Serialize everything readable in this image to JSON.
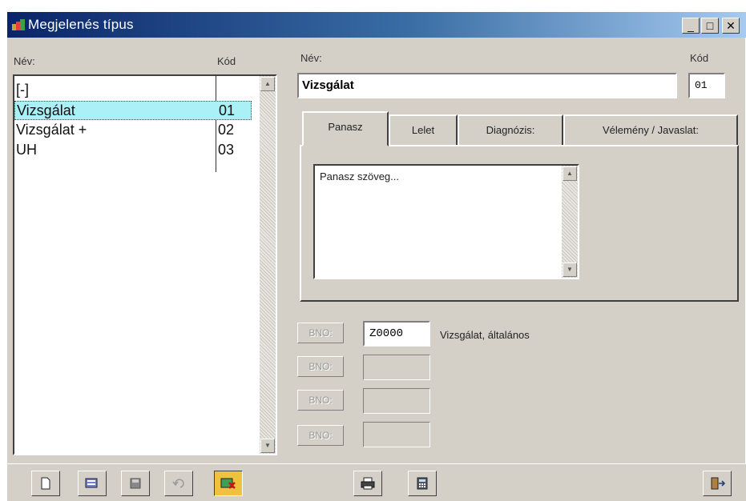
{
  "window": {
    "title": "Megjelenés típus",
    "minimize": "_",
    "maximize": "□",
    "close": "✕"
  },
  "list": {
    "header_nev": "Név:",
    "header_kod": "Kód",
    "rows": [
      {
        "nev": "[-]",
        "kod": ""
      },
      {
        "nev": "Vizsgálat",
        "kod": "01",
        "selected": true
      },
      {
        "nev": "Vizsgálat +",
        "kod": "02"
      },
      {
        "nev": "UH",
        "kod": "03"
      }
    ]
  },
  "form": {
    "nev_label": "Név:",
    "nev_value": "Vizsgálat",
    "kod_label": "Kód",
    "kod_value": "01"
  },
  "tabs": [
    "Panasz",
    "Lelet",
    "Diagnózis:",
    "Vélemény / Javaslat:"
  ],
  "memo_text": "Panasz szöveg...",
  "bno": {
    "button_label": "BNO:",
    "code_value": "Z0000",
    "description": "Vizsgálat, általános"
  },
  "icons": {
    "toolbar": [
      "new-document-icon",
      "edit-icon",
      "save-icon",
      "undo-icon",
      "delete-icon",
      "print-icon",
      "calculator-icon",
      "exit-door-icon"
    ]
  },
  "colors": {
    "selection": "#aaf0f6",
    "title_gradient_start": "#0a246a",
    "title_gradient_end": "#a6caf0",
    "pressed_button": "#f0c040"
  }
}
